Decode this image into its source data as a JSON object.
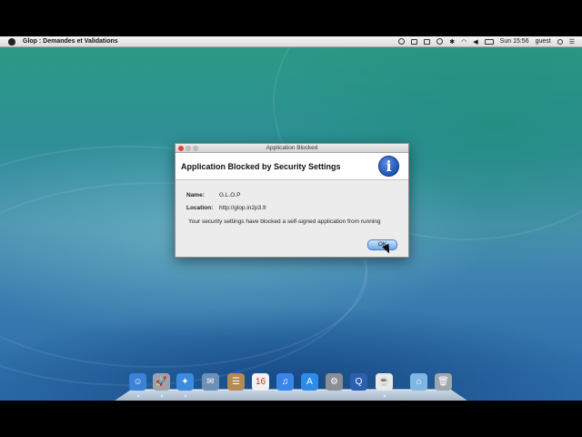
{
  "menubar": {
    "app_name": "Glop : Demandes et Validations",
    "clock": "Sun 15:56",
    "user": "guest",
    "icons": [
      "record-icon",
      "airplay-icon",
      "camera-icon",
      "time-machine-icon",
      "bluetooth-icon",
      "wifi-icon",
      "volume-icon",
      "battery-icon",
      "search-icon",
      "list-icon"
    ]
  },
  "dialog": {
    "window_title": "Application Blocked",
    "header_title": "Application Blocked by Security Settings",
    "name_label": "Name:",
    "name_value": "G.L.O.P",
    "location_label": "Location:",
    "location_value": "http://glop.in2p3.fr",
    "message": "Your security settings have blocked a self-signed application from running",
    "ok_label": "OK"
  },
  "dock": {
    "items": [
      {
        "name": "finder-icon",
        "glyph": "☺",
        "color": "#3b82d6"
      },
      {
        "name": "launchpad-icon",
        "glyph": "🚀",
        "color": "#9aa3ad"
      },
      {
        "name": "safari-icon",
        "glyph": "✦",
        "color": "#3d8be0"
      },
      {
        "name": "mail-icon",
        "glyph": "✉",
        "color": "#6d8fb8"
      },
      {
        "name": "contacts-icon",
        "glyph": "☰",
        "color": "#b48b55"
      },
      {
        "name": "calendar-icon",
        "glyph": "16",
        "color": "#f2f2f2"
      },
      {
        "name": "itunes-icon",
        "glyph": "♫",
        "color": "#3a86e8"
      },
      {
        "name": "app-store-icon",
        "glyph": "A",
        "color": "#2c8ce6"
      },
      {
        "name": "system-preferences-icon",
        "glyph": "⚙",
        "color": "#8a8f96"
      },
      {
        "name": "quicktime-icon",
        "glyph": "Q",
        "color": "#2b5fb0"
      },
      {
        "name": "java-icon",
        "glyph": "☕",
        "color": "#e9e9e9"
      },
      {
        "name": "folder-icon",
        "glyph": "⌂",
        "color": "#7fb6e4"
      },
      {
        "name": "trash-icon",
        "glyph": "🗑",
        "color": "#9ea6ae"
      }
    ]
  }
}
